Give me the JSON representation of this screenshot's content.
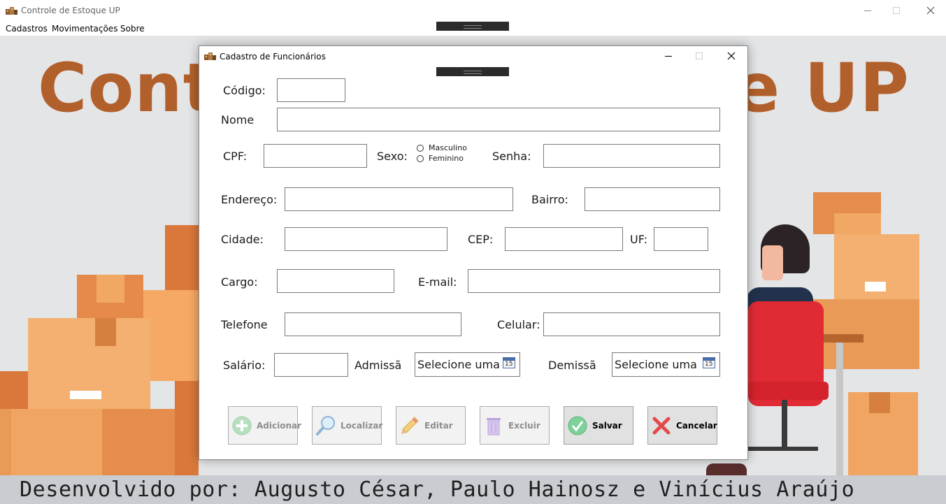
{
  "app": {
    "title": "Controle de Estoque UP",
    "menu": [
      "Cadastros",
      "Movimentações",
      "Sobre"
    ],
    "background_title_left": "Cont",
    "background_title_right": "e UP",
    "footer": "Desenvolvido por: Augusto César, Paulo Hainosz e Vinícius Araújo"
  },
  "dialog": {
    "title": "Cadastro de Funcionários",
    "labels": {
      "codigo": "Código:",
      "nome": "Nome",
      "cpf": "CPF:",
      "sexo": "Sexo:",
      "senha": "Senha:",
      "endereco": "Endereço:",
      "bairro": "Bairro:",
      "cidade": "Cidade:",
      "cep": "CEP:",
      "uf": "UF:",
      "cargo": "Cargo:",
      "email": "E-mail:",
      "telefone": "Telefone",
      "celular": "Celular:",
      "salario": "Salário:",
      "admissao": "Admissã",
      "demissao": "Demissã"
    },
    "sexo_options": [
      "Masculino",
      "Feminino"
    ],
    "date_placeholder": "Selecione uma",
    "calendar_day": "15",
    "buttons": {
      "adicionar": "Adicionar",
      "localizar": "Localizar",
      "editar": "Editar",
      "excluir": "Excluir",
      "salvar": "Salvar",
      "cancelar": "Cancelar"
    }
  },
  "colors": {
    "title_brown": "#b2602b",
    "box_orange": "#e9955a",
    "chair_red": "#e02b35",
    "shirt_navy": "#22324d"
  }
}
